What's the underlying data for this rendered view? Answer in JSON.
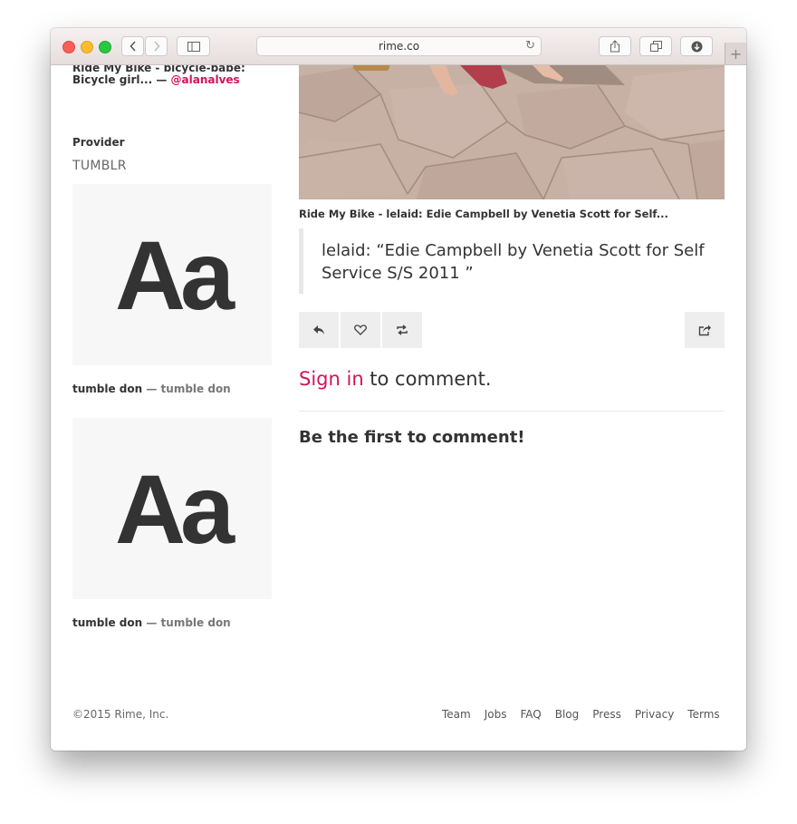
{
  "browser": {
    "url": "rime.co",
    "icons": [
      "back-icon",
      "forward-icon",
      "sidebar-icon",
      "reload-icon",
      "share-icon",
      "tabs-icon",
      "downloads-icon",
      "new-tab-icon"
    ]
  },
  "sidebar": {
    "top_credit_title": "Ride My Bike - bicycle-babe: Bicycle girl...",
    "top_credit_sep": " — ",
    "top_credit_handle": "@alanalves",
    "provider_label": "Provider",
    "provider_value": "TUMBLR",
    "tiles": [
      {
        "glyph": "Aa",
        "title": "tumble don",
        "sep": " — ",
        "subtitle": "tumble don"
      },
      {
        "glyph": "Aa",
        "title": "tumble don",
        "sep": " — ",
        "subtitle": "tumble don"
      }
    ]
  },
  "post": {
    "title": "Ride My Bike - lelaid: Edie Campbell by Venetia Scott for Self...",
    "quote": "lelaid: “Edie Campbell by Venetia Scott for Self Service S/S 2011 ”",
    "actions": [
      "reply-icon",
      "heart-icon",
      "repost-icon",
      "share-icon"
    ]
  },
  "comments": {
    "signin_link": "Sign in",
    "signin_rest": " to comment.",
    "empty_message": "Be the first to comment!"
  },
  "footer": {
    "copyright": "©2015 Rime, Inc.",
    "links": [
      "Team",
      "Jobs",
      "FAQ",
      "Blog",
      "Press",
      "Privacy",
      "Terms"
    ]
  },
  "colors": {
    "accent": "#d4145a",
    "text": "#333333",
    "muted": "#777777"
  }
}
